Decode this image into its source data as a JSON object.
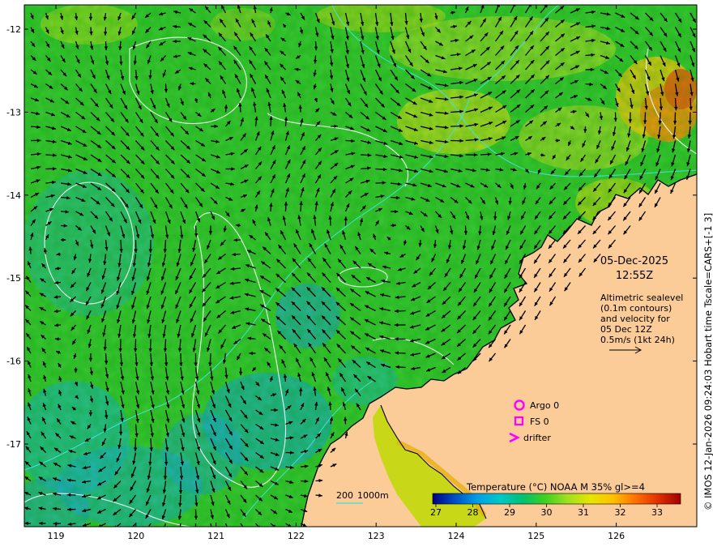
{
  "map": {
    "date_line": "05-Dec-2025",
    "time_line": "12:55Z",
    "info_lines": [
      "Altimetric sealevel",
      "(0.1m contours)",
      "and velocity for",
      "05 Dec 12Z",
      "0.5m/s (1kt 24h)"
    ],
    "credit": "© IMOS 12-Jan-2026 09:24:03 Hobart time Tscale=CARS+[-1 3]",
    "legend": {
      "argo": "Argo 0",
      "fs": "FS 0",
      "drifter": "drifter"
    },
    "depth_labels": [
      "200",
      "1000m"
    ],
    "colorbar": {
      "title": "Temperature (°C) NOAA  M 35% gl>=4",
      "ticks": [
        "27",
        "28",
        "29",
        "30",
        "31",
        "32",
        "33"
      ],
      "colors": [
        "#000080",
        "#0050c8",
        "#00a0e6",
        "#00c8c8",
        "#00c070",
        "#40d020",
        "#a0e020",
        "#e6e600",
        "#ffc000",
        "#ff7000",
        "#e03000",
        "#a00000"
      ]
    },
    "lon_ticks": [
      "119",
      "120",
      "121",
      "122",
      "123",
      "124",
      "125",
      "126"
    ],
    "lat_ticks": [
      "-12",
      "-13",
      "-14",
      "-15",
      "-16",
      "-17"
    ],
    "colors": {
      "land": "#fbcb98",
      "contour": "#ffffff",
      "isobath": "#40e0e0",
      "argo": "#ff00ff",
      "arrow": "#000000"
    }
  }
}
